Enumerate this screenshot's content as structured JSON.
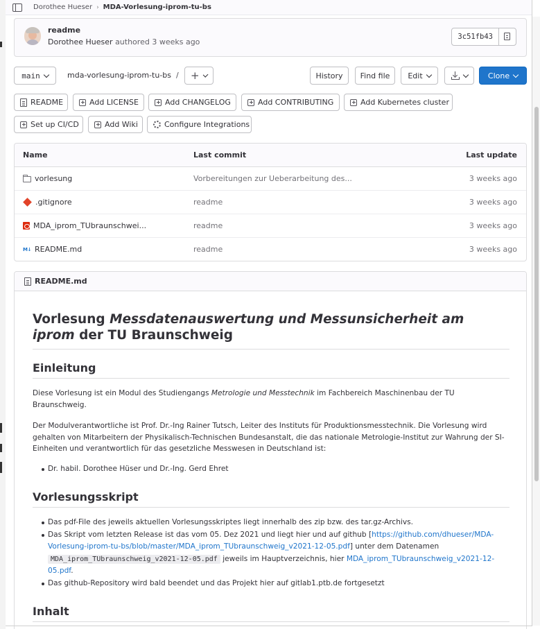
{
  "breadcrumb": {
    "parent": "Dorothee Hueser",
    "current": "MDA-Vorlesung-iprom-tu-bs"
  },
  "commit": {
    "title": "readme",
    "author": "Dorothee Hueser",
    "action": "authored",
    "time": "3 weeks ago",
    "sha": "3c51fb43"
  },
  "toolbar": {
    "branch": "main",
    "repo_path": "mda-vorlesung-iprom-tu-bs",
    "path_separator": "/",
    "add_symbol": "+",
    "history": "History",
    "find_file": "Find file",
    "edit": "Edit",
    "clone": "Clone"
  },
  "shortcuts": [
    "README",
    "Add LICENSE",
    "Add CHANGELOG",
    "Add CONTRIBUTING",
    "Add Kubernetes cluster",
    "Set up CI/CD",
    "Add Wiki",
    "Configure Integrations"
  ],
  "table": {
    "headers": {
      "name": "Name",
      "last_commit": "Last commit",
      "last_update": "Last update"
    },
    "rows": [
      {
        "icon": "folder-icon",
        "name": "vorlesung",
        "commit": "Vorbereitungen zur Ueberarbeitung des...",
        "update": "3 weeks ago"
      },
      {
        "icon": "git-icon",
        "name": ".gitignore",
        "commit": "readme",
        "update": "3 weeks ago"
      },
      {
        "icon": "pdf-icon",
        "name": "MDA_iprom_TUbraunschwei...",
        "commit": "readme",
        "update": "3 weeks ago"
      },
      {
        "icon": "markdown-icon",
        "name": "README.md",
        "commit": "readme",
        "update": "3 weeks ago"
      }
    ]
  },
  "readme": {
    "filename": "README.md",
    "h1_prefix": "Vorlesung ",
    "h1_emph": "Messdatenauswertung und Messunsicherheit am iprom",
    "h1_suffix": " der TU Braunschweig",
    "h2_intro": "Einleitung",
    "p1_a": "Diese Vorlesung ist ein Modul des Studiengangs ",
    "p1_emph": "Metrologie und Messtechnik",
    "p1_b": " im Fachbereich Maschinenbau der TU Braunschweig.",
    "p2": "Der Modulverantwortliche ist Prof. Dr.-Ing Rainer Tutsch, Leiter des Instituts für Produktionsmesstechnik. Die Vorlesung wird gehalten von Mitarbeitern der Physikalisch-Technischen Bundesanstalt, die das nationale Metrologie-Institut zur Wahrung der SI-Einheiten und verantwortlich für das gesetzliche Messwesen in Deutschland ist:",
    "lecturers": "Dr. habil. Dorothee Hüser und Dr.-Ing. Gerd Ehret",
    "h2_script": "Vorlesungsskript",
    "b1": "Das pdf-File des jeweils aktuellen Vorlesungsskriptes liegt innerhalb des zip bzw. des tar.gz-Archivs.",
    "b2_a": "Das Skript vom letzten Release ist das vom 05. Dez 2021 und liegt hier und auf github [",
    "b2_link": "https://github.com/dhueser/MDA-Vorlesung-iprom-tu-bs/blob/master/MDA_iprom_TUbraunschweig_v2021-12-05.pdf",
    "b2_b": "] unter dem Datenamen ",
    "b2_code": "MDA_iprom_TUbraunschweig_v2021-12-05.pdf",
    "b2_c": " jeweils im Hauptverzeichnis, hier ",
    "b2_link2": "MDA_iprom_TUbraunschweig_v2021-12-05.pdf",
    "b2_d": ".",
    "b3": "Das github-Repository wird bald beendet und das Projekt hier auf gitlab1.ptb.de fortgesetzt",
    "h2_content": "Inhalt"
  }
}
